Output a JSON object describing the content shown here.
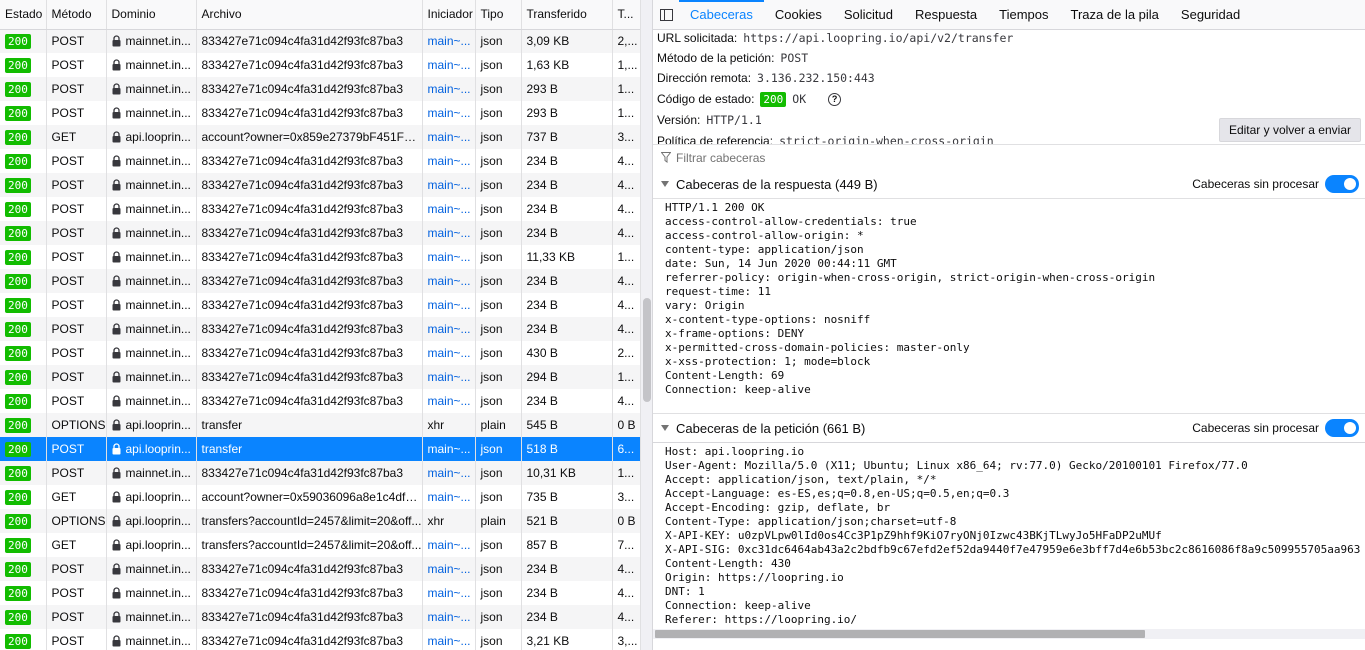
{
  "columns": [
    "Estado",
    "Método",
    "Dominio",
    "Archivo",
    "Iniciador",
    "Tipo",
    "Transferido",
    "T..."
  ],
  "requests": [
    {
      "status": "200",
      "method": "POST",
      "domain": "mainnet.in...",
      "file": "833427e71c094c4fa31d42f93fc87ba3",
      "initiator": "main~...",
      "type": "json",
      "transferred": "3,09 KB",
      "size": "2,..."
    },
    {
      "status": "200",
      "method": "POST",
      "domain": "mainnet.in...",
      "file": "833427e71c094c4fa31d42f93fc87ba3",
      "initiator": "main~...",
      "type": "json",
      "transferred": "1,63 KB",
      "size": "1,..."
    },
    {
      "status": "200",
      "method": "POST",
      "domain": "mainnet.in...",
      "file": "833427e71c094c4fa31d42f93fc87ba3",
      "initiator": "main~...",
      "type": "json",
      "transferred": "293 B",
      "size": "1..."
    },
    {
      "status": "200",
      "method": "POST",
      "domain": "mainnet.in...",
      "file": "833427e71c094c4fa31d42f93fc87ba3",
      "initiator": "main~...",
      "type": "json",
      "transferred": "293 B",
      "size": "1..."
    },
    {
      "status": "200",
      "method": "GET",
      "domain": "api.looprin...",
      "file": "account?owner=0x859e27379bF451F92f...",
      "initiator": "main~...",
      "type": "json",
      "transferred": "737 B",
      "size": "3..."
    },
    {
      "status": "200",
      "method": "POST",
      "domain": "mainnet.in...",
      "file": "833427e71c094c4fa31d42f93fc87ba3",
      "initiator": "main~...",
      "type": "json",
      "transferred": "234 B",
      "size": "4..."
    },
    {
      "status": "200",
      "method": "POST",
      "domain": "mainnet.in...",
      "file": "833427e71c094c4fa31d42f93fc87ba3",
      "initiator": "main~...",
      "type": "json",
      "transferred": "234 B",
      "size": "4..."
    },
    {
      "status": "200",
      "method": "POST",
      "domain": "mainnet.in...",
      "file": "833427e71c094c4fa31d42f93fc87ba3",
      "initiator": "main~...",
      "type": "json",
      "transferred": "234 B",
      "size": "4..."
    },
    {
      "status": "200",
      "method": "POST",
      "domain": "mainnet.in...",
      "file": "833427e71c094c4fa31d42f93fc87ba3",
      "initiator": "main~...",
      "type": "json",
      "transferred": "234 B",
      "size": "4..."
    },
    {
      "status": "200",
      "method": "POST",
      "domain": "mainnet.in...",
      "file": "833427e71c094c4fa31d42f93fc87ba3",
      "initiator": "main~...",
      "type": "json",
      "transferred": "11,33 KB",
      "size": "1..."
    },
    {
      "status": "200",
      "method": "POST",
      "domain": "mainnet.in...",
      "file": "833427e71c094c4fa31d42f93fc87ba3",
      "initiator": "main~...",
      "type": "json",
      "transferred": "234 B",
      "size": "4..."
    },
    {
      "status": "200",
      "method": "POST",
      "domain": "mainnet.in...",
      "file": "833427e71c094c4fa31d42f93fc87ba3",
      "initiator": "main~...",
      "type": "json",
      "transferred": "234 B",
      "size": "4..."
    },
    {
      "status": "200",
      "method": "POST",
      "domain": "mainnet.in...",
      "file": "833427e71c094c4fa31d42f93fc87ba3",
      "initiator": "main~...",
      "type": "json",
      "transferred": "234 B",
      "size": "4..."
    },
    {
      "status": "200",
      "method": "POST",
      "domain": "mainnet.in...",
      "file": "833427e71c094c4fa31d42f93fc87ba3",
      "initiator": "main~...",
      "type": "json",
      "transferred": "430 B",
      "size": "2..."
    },
    {
      "status": "200",
      "method": "POST",
      "domain": "mainnet.in...",
      "file": "833427e71c094c4fa31d42f93fc87ba3",
      "initiator": "main~...",
      "type": "json",
      "transferred": "294 B",
      "size": "1..."
    },
    {
      "status": "200",
      "method": "POST",
      "domain": "mainnet.in...",
      "file": "833427e71c094c4fa31d42f93fc87ba3",
      "initiator": "main~...",
      "type": "json",
      "transferred": "234 B",
      "size": "4..."
    },
    {
      "status": "200",
      "method": "OPTIONS",
      "domain": "api.looprin...",
      "file": "transfer",
      "initiator": "xhr",
      "type": "plain",
      "transferred": "545 B",
      "size": "0 B"
    },
    {
      "status": "200",
      "method": "POST",
      "domain": "api.looprin...",
      "file": "transfer",
      "initiator": "main~...",
      "type": "json",
      "transferred": "518 B",
      "size": "6..."
    },
    {
      "status": "200",
      "method": "POST",
      "domain": "mainnet.in...",
      "file": "833427e71c094c4fa31d42f93fc87ba3",
      "initiator": "main~...",
      "type": "json",
      "transferred": "10,31 KB",
      "size": "1..."
    },
    {
      "status": "200",
      "method": "GET",
      "domain": "api.looprin...",
      "file": "account?owner=0x59036096a8e1c4df6e...",
      "initiator": "main~...",
      "type": "json",
      "transferred": "735 B",
      "size": "3..."
    },
    {
      "status": "200",
      "method": "OPTIONS",
      "domain": "api.looprin...",
      "file": "transfers?accountId=2457&limit=20&off...",
      "initiator": "xhr",
      "type": "plain",
      "transferred": "521 B",
      "size": "0 B"
    },
    {
      "status": "200",
      "method": "GET",
      "domain": "api.looprin...",
      "file": "transfers?accountId=2457&limit=20&off...",
      "initiator": "main~...",
      "type": "json",
      "transferred": "857 B",
      "size": "7..."
    },
    {
      "status": "200",
      "method": "POST",
      "domain": "mainnet.in...",
      "file": "833427e71c094c4fa31d42f93fc87ba3",
      "initiator": "main~...",
      "type": "json",
      "transferred": "234 B",
      "size": "4..."
    },
    {
      "status": "200",
      "method": "POST",
      "domain": "mainnet.in...",
      "file": "833427e71c094c4fa31d42f93fc87ba3",
      "initiator": "main~...",
      "type": "json",
      "transferred": "234 B",
      "size": "4..."
    },
    {
      "status": "200",
      "method": "POST",
      "domain": "mainnet.in...",
      "file": "833427e71c094c4fa31d42f93fc87ba3",
      "initiator": "main~...",
      "type": "json",
      "transferred": "234 B",
      "size": "4..."
    },
    {
      "status": "200",
      "method": "POST",
      "domain": "mainnet.in...",
      "file": "833427e71c094c4fa31d42f93fc87ba3",
      "initiator": "main~...",
      "type": "json",
      "transferred": "3,21 KB",
      "size": "3,..."
    }
  ],
  "selected_index": 17,
  "tabs": [
    "Cabeceras",
    "Cookies",
    "Solicitud",
    "Respuesta",
    "Tiempos",
    "Traza de la pila",
    "Seguridad"
  ],
  "active_tab": 0,
  "summary": {
    "url_label": "URL solicitada:",
    "url": "https://api.loopring.io/api/v2/transfer",
    "method_label": "Método de la petición:",
    "method": "POST",
    "remote_label": "Dirección remota:",
    "remote": "3.136.232.150:443",
    "status_label": "Código de estado:",
    "status_code": "200",
    "status_text": "OK",
    "version_label": "Versión:",
    "version": "HTTP/1.1",
    "referrer_label": "Política de referencia:",
    "referrer": "strict-origin-when-cross-origin"
  },
  "resend_label": "Editar y volver a enviar",
  "filter_placeholder": "Filtrar cabeceras",
  "raw_label": "Cabeceras sin procesar",
  "response_section": "Cabeceras de la respuesta (449 B)",
  "request_section": "Cabeceras de la petición (661 B)",
  "response_headers": [
    "HTTP/1.1 200 OK",
    "access-control-allow-credentials: true",
    "access-control-allow-origin: *",
    "content-type: application/json",
    "date: Sun, 14 Jun 2020 00:44:11 GMT",
    "referrer-policy: origin-when-cross-origin, strict-origin-when-cross-origin",
    "request-time: 11",
    "vary: Origin",
    "x-content-type-options: nosniff",
    "x-frame-options: DENY",
    "x-permitted-cross-domain-policies: master-only",
    "x-xss-protection: 1; mode=block",
    "Content-Length: 69",
    "Connection: keep-alive"
  ],
  "request_headers": [
    "Host: api.loopring.io",
    "User-Agent: Mozilla/5.0 (X11; Ubuntu; Linux x86_64; rv:77.0) Gecko/20100101 Firefox/77.0",
    "Accept: application/json, text/plain, */*",
    "Accept-Language: es-ES,es;q=0.8,en-US;q=0.5,en;q=0.3",
    "Accept-Encoding: gzip, deflate, br",
    "Content-Type: application/json;charset=utf-8",
    "X-API-KEY: u0zpVLpw0lId0os4Cc3P1pZ9hhf9KiO7ryONj0Izwc43BKjTLwyJo5HFaDP2uMUf",
    "X-API-SIG: 0xc31dc6464ab43a2c2bdfb9c67efd2ef52da9440f7e47959e6e3bff7d4e6b53bc2c8616086f8a9c509955705aa963",
    "Content-Length: 430",
    "Origin: https://loopring.io",
    "DNT: 1",
    "Connection: keep-alive",
    "Referer: https://loopring.io/"
  ],
  "colors": {
    "accent": "#0a84ff",
    "status_ok": "#12bc00",
    "link": "#0060df"
  }
}
